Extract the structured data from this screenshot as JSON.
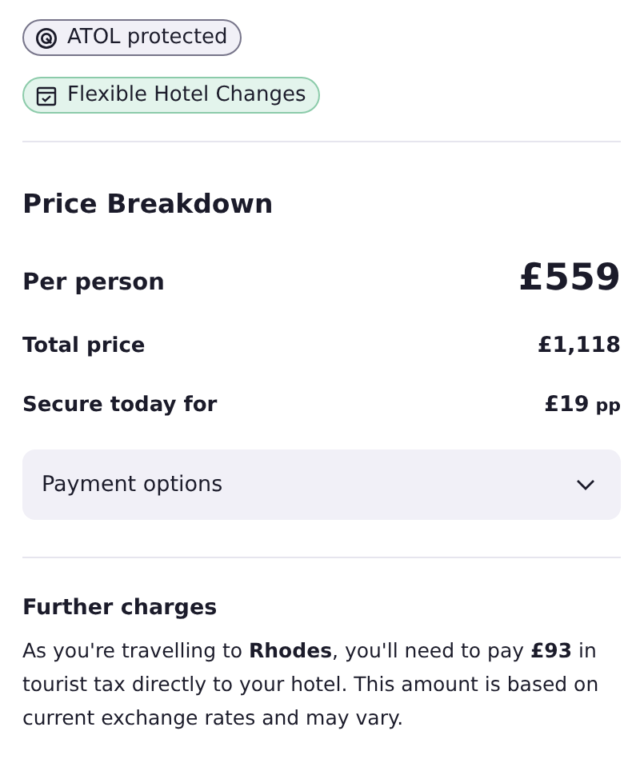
{
  "badges": [
    {
      "kind": "atol",
      "label": "ATOL protected"
    },
    {
      "kind": "flexible",
      "label": "Flexible Hotel Changes"
    }
  ],
  "price_breakdown": {
    "title": "Price Breakdown",
    "rows": [
      {
        "kind": "main",
        "label": "Per person",
        "value": "£559"
      },
      {
        "kind": "plain",
        "label": "Total price",
        "value": "£1,118"
      },
      {
        "kind": "plain",
        "label": "Secure today for",
        "value": "£19",
        "suffix": "pp"
      }
    ],
    "payment_options": {
      "label": "Payment options",
      "expanded": false
    }
  },
  "further_charges": {
    "title": "Further charges",
    "text": "As you're travelling to **Rhodes**, you'll need to pay **£93** in tourist tax directly to your hotel. This amount is based on current exchange rates and may vary."
  }
}
